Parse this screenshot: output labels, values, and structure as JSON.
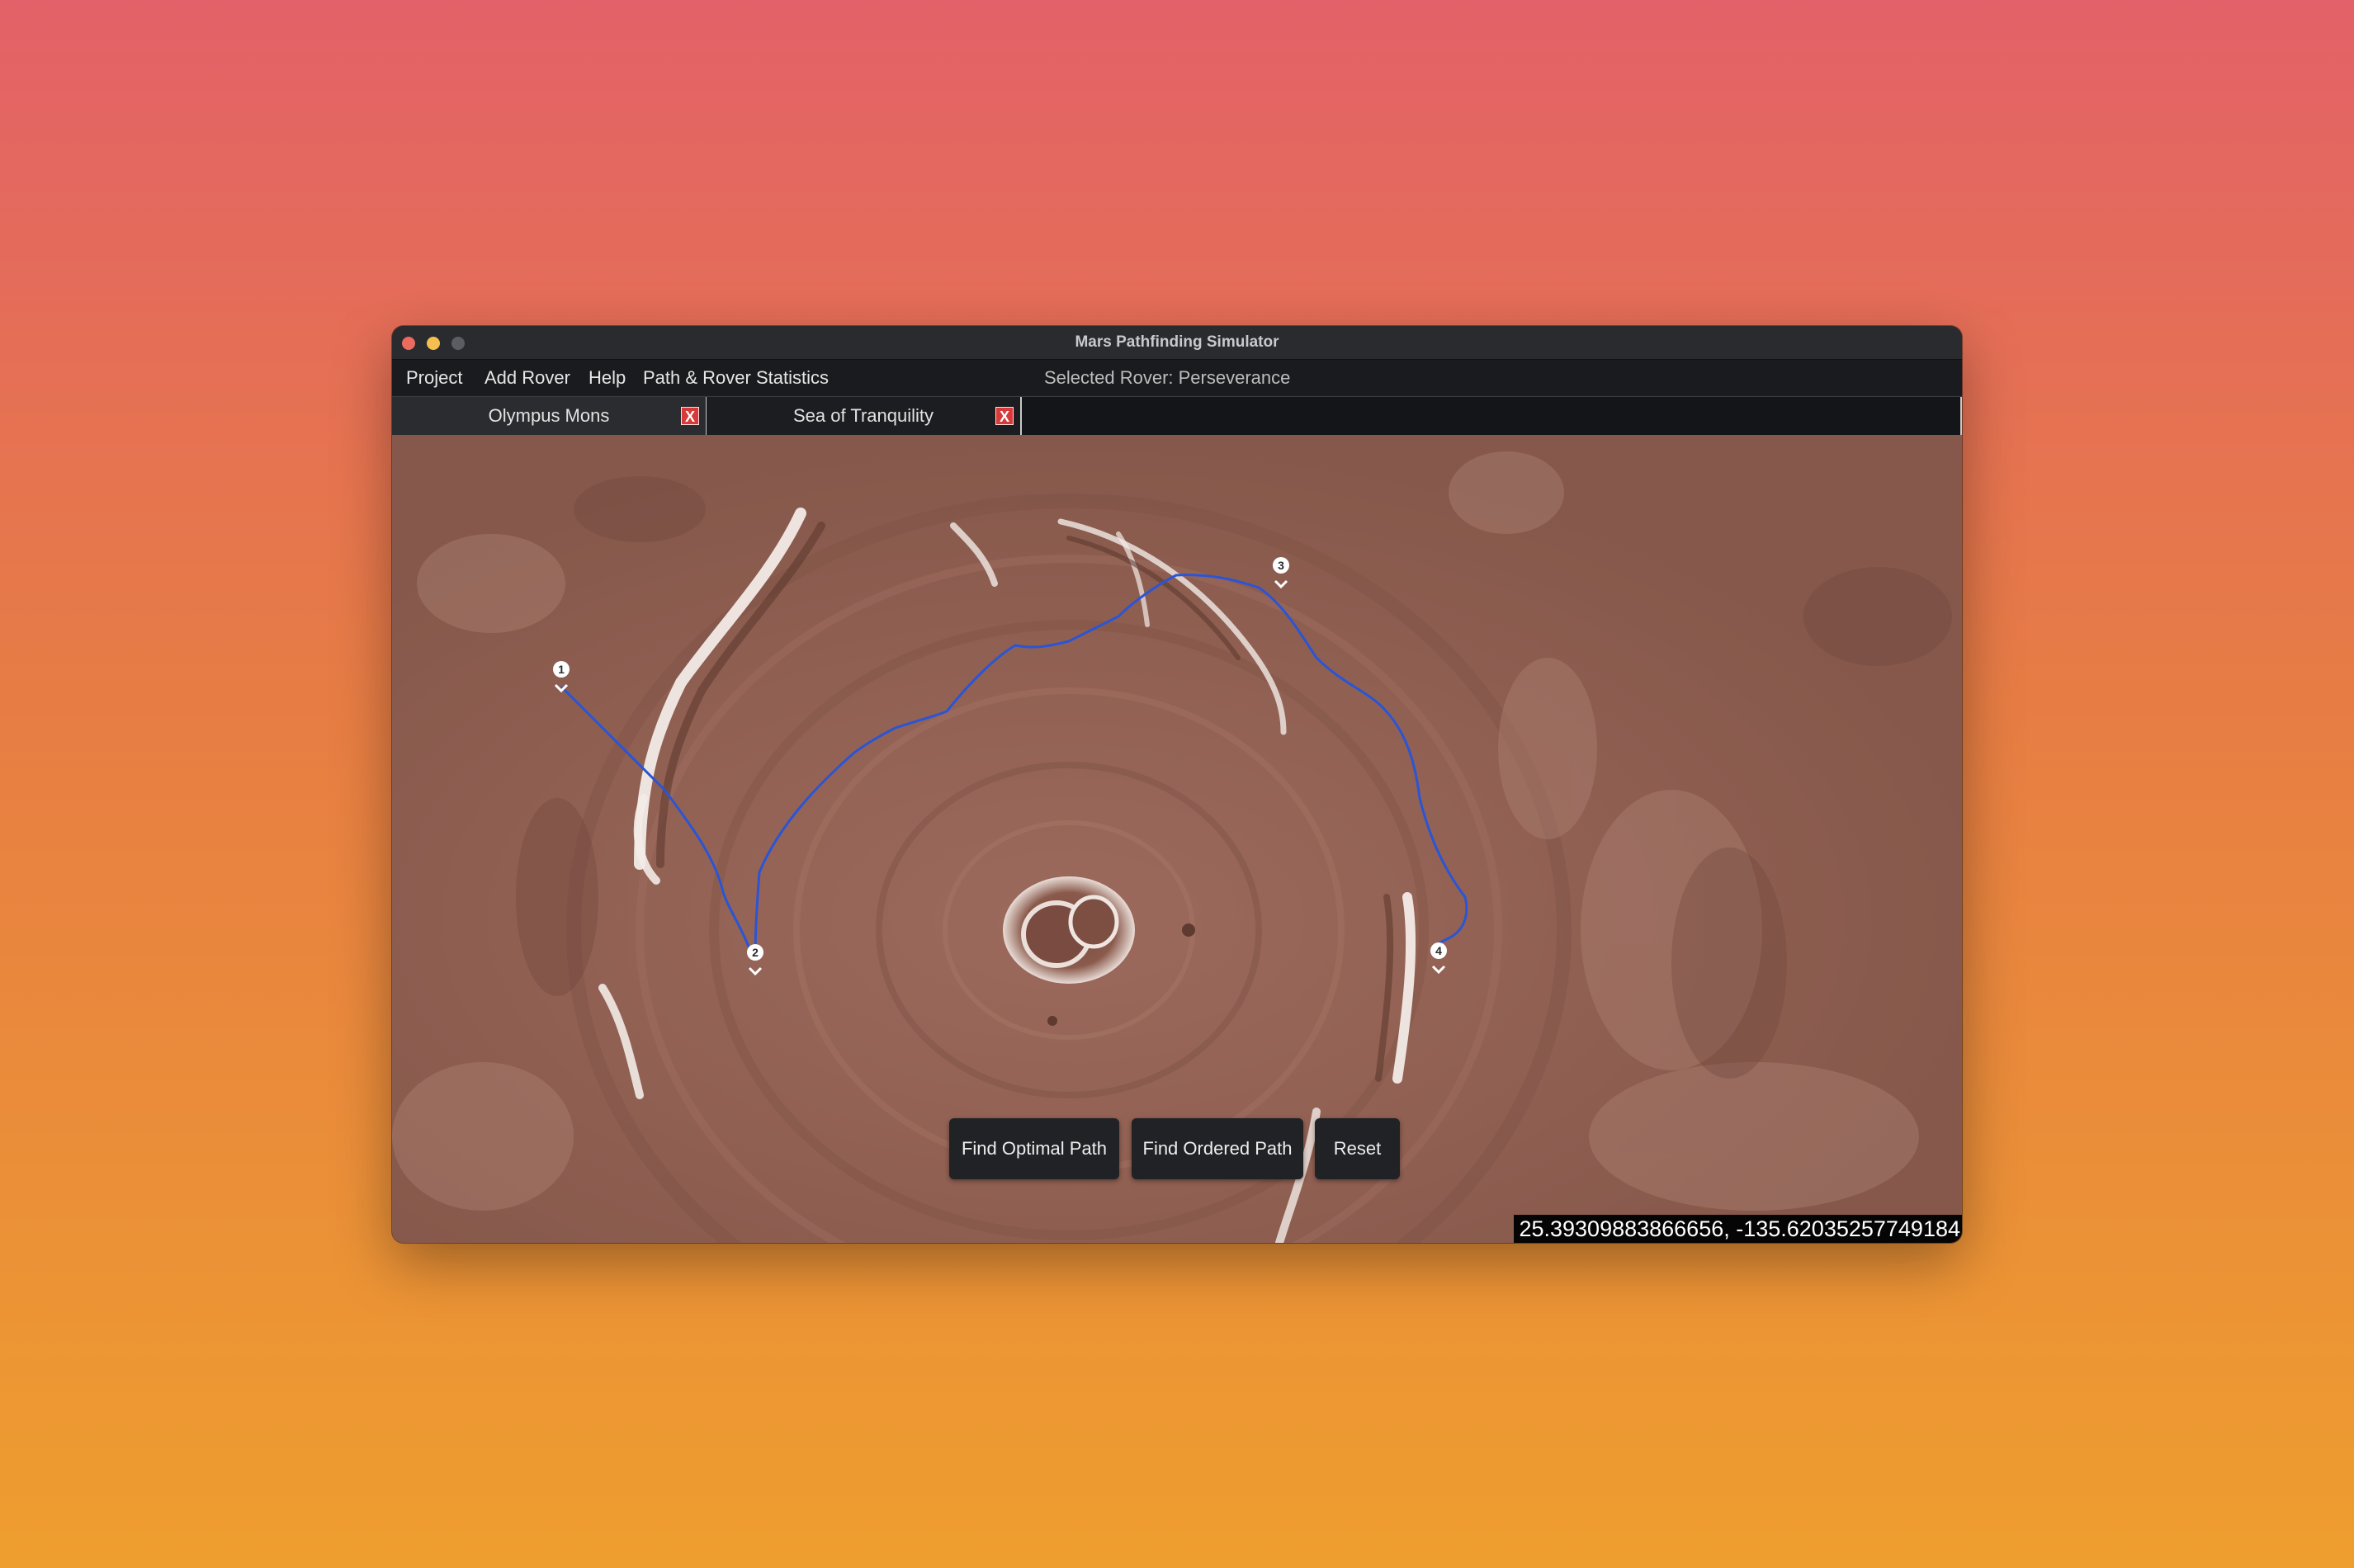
{
  "window": {
    "title": "Mars Pathfinding Simulator"
  },
  "menu": {
    "items": [
      "Project",
      "Add Rover",
      "Help",
      "Path & Rover Statistics"
    ],
    "selected_rover": "Selected Rover: Perseverance"
  },
  "tabs": [
    {
      "label": "Olympus Mons",
      "close": "X",
      "active": true
    },
    {
      "label": "Sea of Tranquility",
      "close": "X",
      "active": false
    }
  ],
  "map": {
    "waypoints": [
      "1",
      "2",
      "3",
      "4"
    ],
    "path_color": "#2a55d6",
    "coordinates": "25.39309883866656, -135.62035257749184"
  },
  "actions": {
    "find_optimal": "Find Optimal Path",
    "find_ordered": "Find Ordered Path",
    "reset": "Reset"
  },
  "colors": {
    "terrain": "#8e5d50",
    "tab_close": "#d63a3a"
  }
}
